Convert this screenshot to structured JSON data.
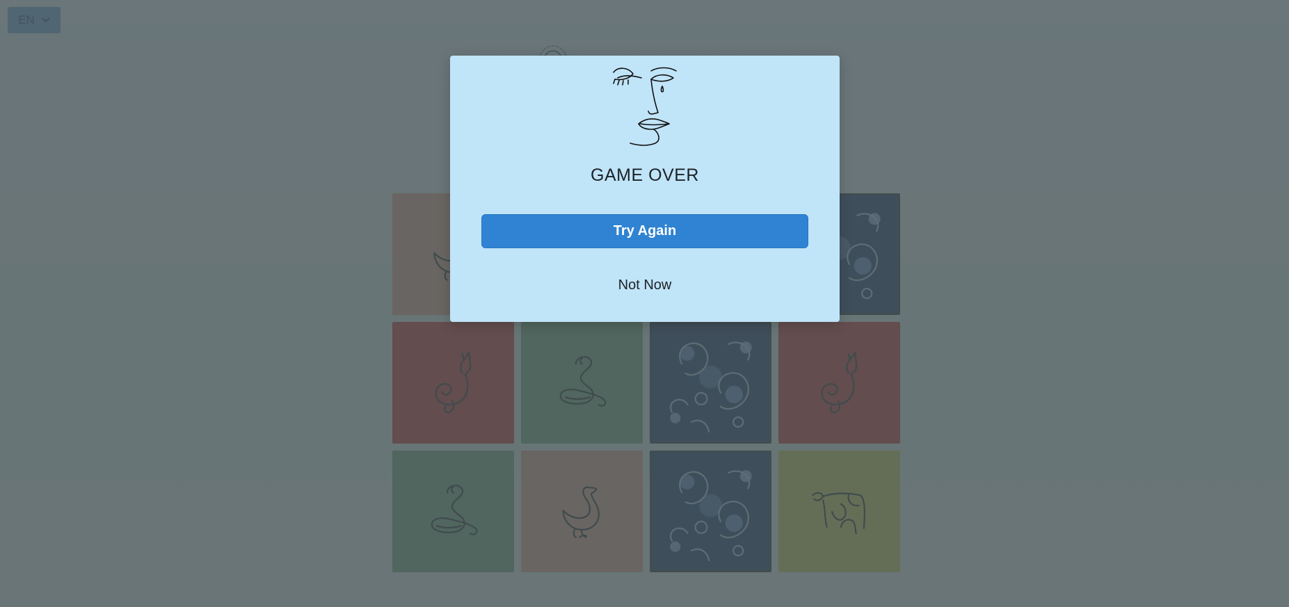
{
  "language_selector": {
    "value": "EN",
    "icon": "chevron-down-icon"
  },
  "board": {
    "cards": [
      {
        "state": "face-up",
        "animal": "goose",
        "color": "#f3a281"
      },
      {
        "state": "hidden",
        "animal": "",
        "color": "#0e2359"
      },
      {
        "state": "hidden",
        "animal": "",
        "color": "#0e2359"
      },
      {
        "state": "face-down",
        "animal": "",
        "color": "#0e2359"
      },
      {
        "state": "face-up",
        "animal": "cat",
        "color": "#d21f11"
      },
      {
        "state": "face-up",
        "animal": "snake",
        "color": "#6ea46c"
      },
      {
        "state": "face-down",
        "animal": "",
        "color": "#0e2359"
      },
      {
        "state": "face-up",
        "animal": "cat",
        "color": "#d21f11"
      },
      {
        "state": "face-up",
        "animal": "snake",
        "color": "#6ea46c"
      },
      {
        "state": "face-up",
        "animal": "goose",
        "color": "#f3a281"
      },
      {
        "state": "face-down",
        "animal": "",
        "color": "#0e2359"
      },
      {
        "state": "face-up",
        "animal": "cow",
        "color": "#d7d444"
      }
    ]
  },
  "modal": {
    "icon": "crying-face-icon",
    "title": "GAME OVER",
    "primary_button": "Try Again",
    "secondary_button": "Not Now",
    "colors": {
      "background": "#c0e4f8",
      "primary": "#2f83d2"
    }
  }
}
